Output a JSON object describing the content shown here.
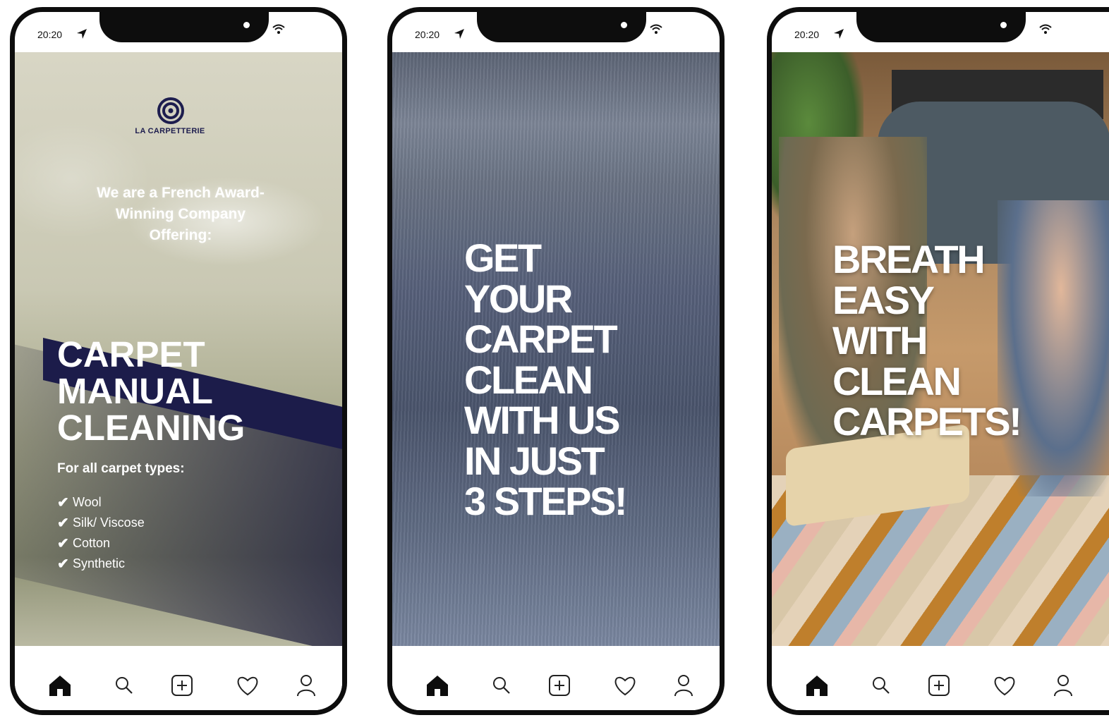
{
  "status_bar": {
    "time": "20:20"
  },
  "icons": {
    "status": [
      "navigation-arrow-icon",
      "wifi-icon"
    ],
    "tabbar": [
      "home-icon",
      "search-icon",
      "add-icon",
      "heart-icon",
      "profile-icon"
    ]
  },
  "screens": [
    {
      "logo_text": "LA CARPETTERIE",
      "intro": "We are a French Award-Winning Company Offering:",
      "headline_lines": [
        "CARPET",
        "MANUAL",
        "CLEANING"
      ],
      "subheading": "For all carpet types:",
      "carpet_types": [
        "Wool",
        "Silk/ Viscose",
        "Cotton",
        "Synthetic"
      ]
    },
    {
      "headline_lines": [
        "GET",
        "YOUR",
        "CARPET",
        "CLEAN",
        "WITH US",
        "IN JUST",
        "3 STEPS!"
      ]
    },
    {
      "headline_lines": [
        "BREATH",
        "EASY",
        "WITH",
        "CLEAN",
        "CARPETS!"
      ]
    }
  ],
  "colors": {
    "brand_navy": "#1d1d4e",
    "phone_frame": "#0d0d0d"
  }
}
